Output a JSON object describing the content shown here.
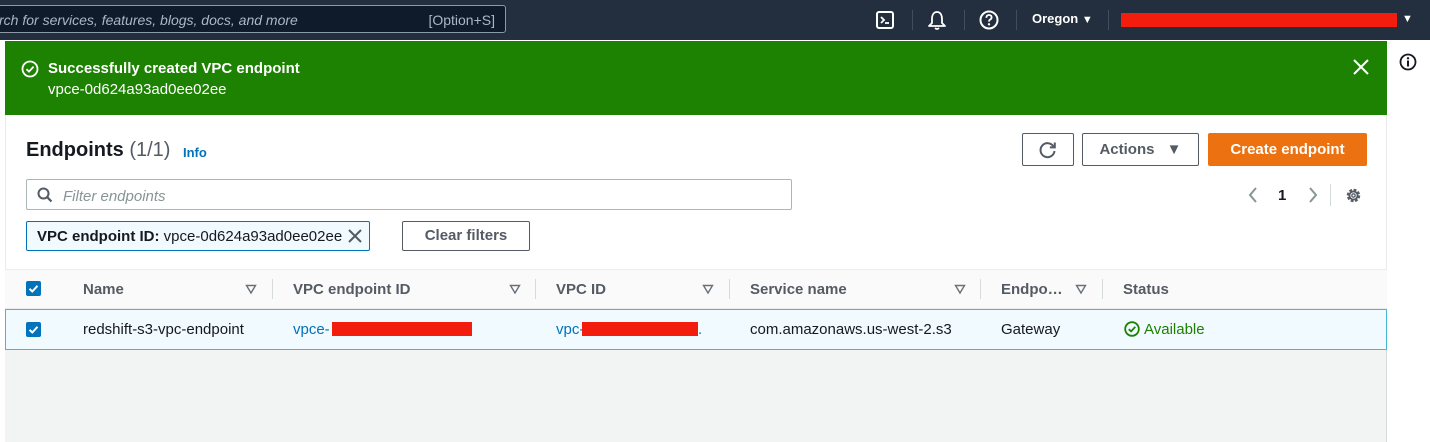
{
  "topnav": {
    "search_placeholder": "rch for services, features, blogs, docs, and more",
    "search_shortcut": "[Option+S]",
    "region": "Oregon",
    "icons": [
      "cloudshell-icon",
      "notifications-bell-icon",
      "help-icon",
      "info-icon"
    ]
  },
  "banner": {
    "title": "Successfully created VPC endpoint",
    "endpoint_id": "vpce-0d624a93ad0ee02ee",
    "color": "#1d8102"
  },
  "header": {
    "title": "Endpoints",
    "count": "(1/1)",
    "info_link": "Info"
  },
  "toolbar": {
    "actions_label": "Actions",
    "create_label": "Create endpoint",
    "create_color": "#ec7211"
  },
  "filter": {
    "placeholder": "Filter endpoints",
    "token_label": "VPC endpoint ID:",
    "token_value": "vpce-0d624a93ad0ee02ee",
    "clear_label": "Clear filters"
  },
  "pagination": {
    "current_page": "1"
  },
  "table": {
    "columns": [
      "Name",
      "VPC endpoint ID",
      "VPC ID",
      "Service name",
      "Endpo…",
      "Status"
    ],
    "rows": [
      {
        "selected": true,
        "name": "redshift-s3-vpc-endpoint",
        "vpc_endpoint_id_prefix": "vpce-",
        "vpc_id_prefix": "vpc-",
        "vpc_id_suffix": ".",
        "service_name": "com.amazonaws.us-west-2.s3",
        "endpoint_type": "Gateway",
        "status": "Available",
        "status_color": "#1d8102"
      }
    ]
  }
}
